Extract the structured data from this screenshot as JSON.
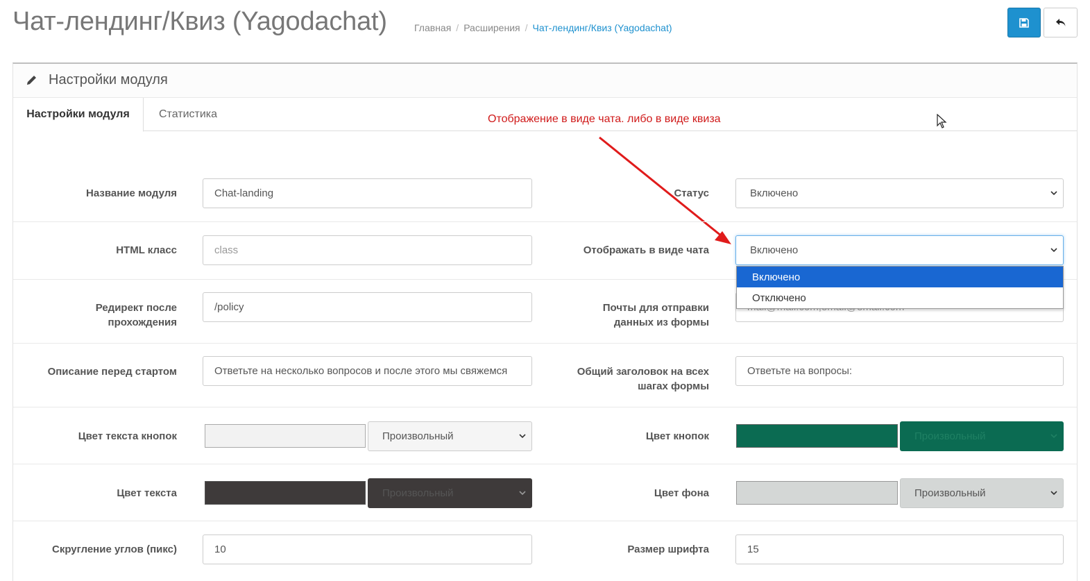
{
  "header": {
    "title": "Чат-лендинг/Квиз (Yagodachat)",
    "breadcrumb": [
      "Главная",
      "Расширения",
      "Чат-лендинг/Квиз (Yagodachat)"
    ]
  },
  "toolbar": {
    "save_icon": "save-icon",
    "back_icon": "reply-icon",
    "save_color": "#1e91cf"
  },
  "panel": {
    "title": "Настройки модуля",
    "icon": "pencil-icon"
  },
  "tabs": [
    "Настройки модуля",
    "Статистика"
  ],
  "annotation": "Отображение в виде чата. либо в виде квиза",
  "form": {
    "module_name": {
      "label": "Название модуля",
      "value": "Chat-landing"
    },
    "status": {
      "label": "Статус",
      "value": "Включено"
    },
    "html_class": {
      "label": "HTML класс",
      "placeholder": "class"
    },
    "chat_view": {
      "label": "Отображать в виде чата",
      "value": "Включено",
      "options": [
        "Включено",
        "Отключено"
      ]
    },
    "redirect": {
      "label_1": "Редирект после",
      "label_2": "прохождения",
      "value": "/policy"
    },
    "emails": {
      "label_1": "Почты для отправки",
      "label_2": "данных из формы",
      "placeholder": "mail@mail.com,email@email.com"
    },
    "description": {
      "label": "Описание перед стартом",
      "value": "Ответьте на несколько вопросов и после этого мы свяжемся"
    },
    "common_title": {
      "label_1": "Общий заголовок на всех",
      "label_2": "шагах формы",
      "value": "Ответьте на вопросы:"
    },
    "btn_text_color": {
      "label": "Цвет текста кнопок",
      "select": "Произвольный",
      "color": "#f2f2f2"
    },
    "btn_color": {
      "label": "Цвет кнопок",
      "select": "Произвольный",
      "color": "#0b6b52"
    },
    "text_color": {
      "label": "Цвет текста",
      "select": "Произвольный",
      "color": "#3e3a3a"
    },
    "bg_color": {
      "label": "Цвет фона",
      "select": "Произвольный",
      "color": "#d4d7d6"
    },
    "radius": {
      "label": "Скругление углов (пикс)",
      "value": "10"
    },
    "font_size": {
      "label": "Размер шрифта",
      "value": "15"
    }
  }
}
